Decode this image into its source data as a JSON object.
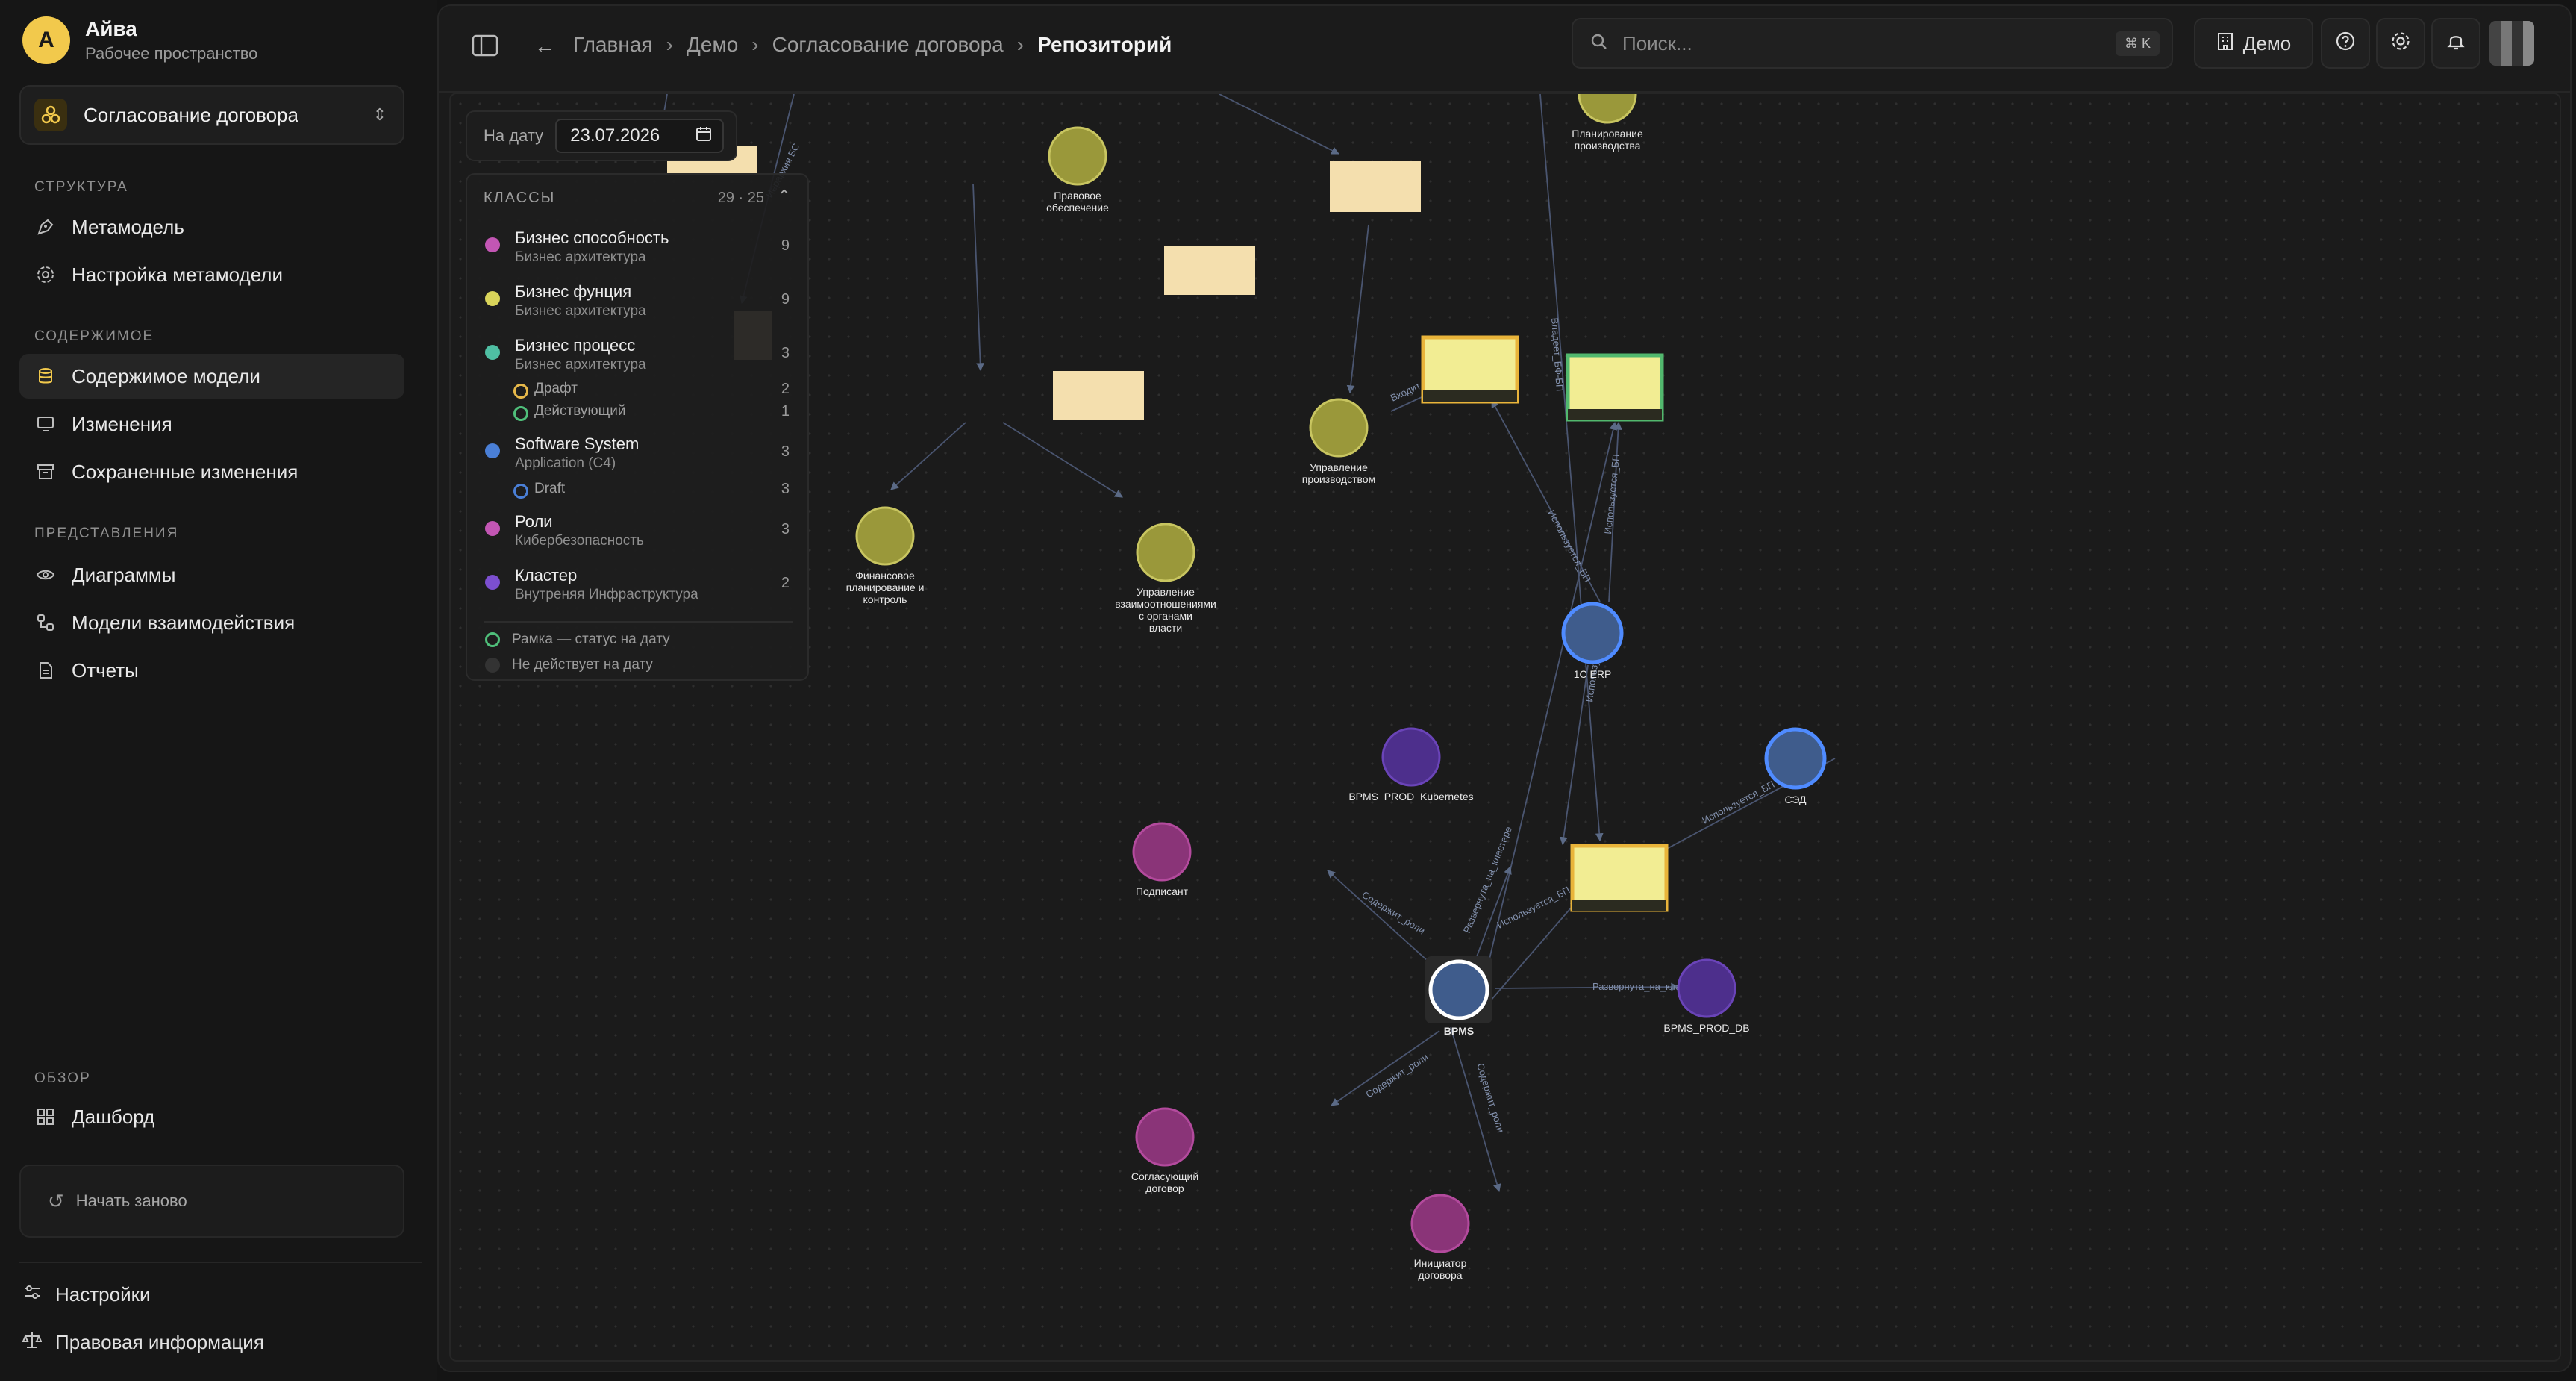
{
  "workspace": {
    "avatar": "А",
    "name": "Айва",
    "subtitle": "Рабочее пространство"
  },
  "project": {
    "name": "Согласование договора"
  },
  "sidebar": {
    "structure_title": "СТРУКТУРА",
    "metamodel": "Метамодель",
    "metamodel_settings": "Настройка метамодели",
    "content_title": "СОДЕРЖИМОЕ",
    "model_content": "Содержимое модели",
    "changes": "Изменения",
    "saved_changes": "Сохраненные изменения",
    "views_title": "ПРЕДСТАВЛЕНИЯ",
    "diagrams": "Диаграммы",
    "interaction_models": "Модели взаимодействия",
    "reports": "Отчеты",
    "overview_title": "ОБЗОР",
    "dashboard": "Дашборд",
    "restart": "Начать заново",
    "settings": "Настройки",
    "legal": "Правовая информация"
  },
  "breadcrumbs": [
    "Главная",
    "Демо",
    "Согласование договора",
    "Репозиторий"
  ],
  "search": {
    "placeholder": "Поиск...",
    "shortcut": "⌘ K"
  },
  "topbar": {
    "workspace_button": "Демо"
  },
  "date_filter": {
    "label": "На дату",
    "value": "23.07.2026"
  },
  "legend": {
    "title": "КЛАССЫ",
    "count": "29 · 25",
    "classes": [
      {
        "name": "Бизнес способность",
        "sub": "Бизнес архитектура",
        "count": "9",
        "color": "#c356b4"
      },
      {
        "name": "Бизнес фунция",
        "sub": "Бизнес архитектура",
        "count": "9",
        "color": "#d9d45a"
      },
      {
        "name": "Бизнес процесс",
        "sub": "Бизнес архитектура",
        "count": "3",
        "color": "#4fbfa3"
      },
      {
        "name": "Software System",
        "sub": "Application (C4)",
        "count": "3",
        "color": "#4a7fd6"
      },
      {
        "name": "Роли",
        "sub": "Кибербезопасность",
        "count": "3",
        "color": "#c356b4"
      },
      {
        "name": "Кластер",
        "sub": "Внутреняя Инфраструктура",
        "count": "2",
        "color": "#7c4fd0"
      }
    ],
    "process_statuses": [
      {
        "name": "Драфт",
        "count": "2",
        "color": "#e6b84a"
      },
      {
        "name": "Действующий",
        "count": "1",
        "color": "#4fbf7a"
      }
    ],
    "system_statuses": [
      {
        "name": "Draft",
        "count": "3",
        "color": "#4a7fd6"
      }
    ],
    "note_frame": "Рамка — статус на дату",
    "note_inactive": "Не действует на дату"
  },
  "graph": {
    "nodes": {
      "pravovoe": [
        "Правовое",
        "обеспечение"
      ],
      "planirovanie": [
        "Планирование",
        "производства"
      ],
      "upr_proizv": [
        "Управление",
        "производством"
      ],
      "fin": [
        "Финансовое",
        "планирование и",
        "контроль"
      ],
      "upr_vzaim": [
        "Управление",
        "взаимоотношениями",
        "с органами",
        "власти"
      ],
      "erp": [
        "1С ERP"
      ],
      "kubernetes": [
        "BPMS_PROD_Kubernetes"
      ],
      "sed": [
        "СЭД"
      ],
      "podpisant": [
        "Подписант"
      ],
      "bpms": [
        "BPMS"
      ],
      "bpms_db": [
        "BPMS_PROD_DB"
      ],
      "soglas": [
        "Согласующий",
        "договор"
      ],
      "iniciator": [
        "Инициатор",
        "договора"
      ]
    },
    "edges": {
      "deployed_cluster": "Развернута_на_кластере",
      "deployed_cluster2": "Развернута_на_кластере",
      "uses_bp": "Используется_БП",
      "uses_bp2": "Используется_БП",
      "uses_bp3": "Используется_БП",
      "uses_bp4": "Используется_БП",
      "uses_bp5": "Используется_БП",
      "contains_role": "Содержит_роли",
      "contains_role2": "Содержит_роли",
      "contains_role3": "Содержит_роли",
      "owner_bf": "Владеет_БФ-БП",
      "part_bf": "Входит_БФ-БП",
      "parent_bs": "Иерархия БС"
    }
  },
  "colors": {
    "accent": "#f2c94c",
    "bg": "#141414"
  }
}
